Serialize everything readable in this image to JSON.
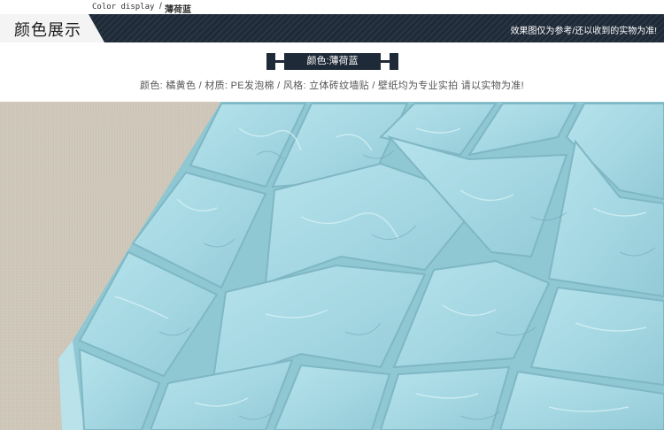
{
  "header": {
    "caption_en": "Color display",
    "caption_slash": "/",
    "caption_cn": "薄荷蓝",
    "section_title": "颜色展示",
    "note": "效果图仅为参考/还以收到的实物为准!"
  },
  "color_tag": {
    "label": "颜色:薄荷蓝"
  },
  "spec": {
    "text": "颜色: 橘黄色 / 材质: PE发泡棉 / 风格: 立体砖纹墙贴 / 壁纸均为专业实拍 请以实物为准!"
  },
  "colors": {
    "band": "#1f2a38",
    "tile": "#a9dbe6",
    "background_fabric": "#cfc8ba"
  }
}
